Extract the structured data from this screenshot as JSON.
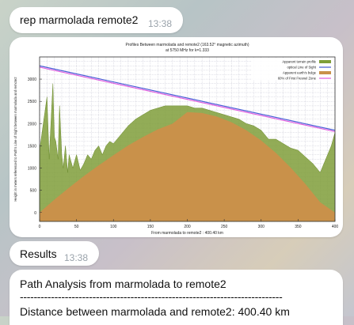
{
  "messages": [
    {
      "text": "rep marmolada remote2",
      "time": "13:38"
    },
    {
      "time": "13:38"
    },
    {
      "text": "Results",
      "time": "13:38"
    },
    {
      "lines": [
        "Path Analysis from marmolada to remote2",
        "----------------------------------------------------------------------------",
        "Distance between marmolada and remote2: 400.40 km"
      ]
    }
  ],
  "chart_data": {
    "type": "area",
    "title": "Profiles Between marmolada and remote2 (163.52° magnetic azimuth)",
    "subtitle": "at 5750 MHz for k=1.333",
    "xlabel": "From marmolada to remote2 : 400.40 km",
    "ylabel": "Height in meters referenced to Path's Line of Sight between marmolada and remote2",
    "xlim": [
      0,
      400
    ],
    "ylim": [
      -200,
      3500
    ],
    "xticks": [
      "0",
      "50",
      "100",
      "150",
      "200",
      "250",
      "300",
      "350",
      "400"
    ],
    "yticks": [
      "0",
      "500",
      "1000",
      "1500",
      "2000",
      "2500",
      "3000"
    ],
    "grid": true,
    "legend_position": "top-right",
    "series": [
      {
        "name": "Apparent terrain profile",
        "color": "#7f9e3a",
        "x": [
          0,
          5,
          10,
          13,
          15,
          18,
          20,
          22,
          25,
          27,
          30,
          32,
          35,
          38,
          40,
          45,
          50,
          55,
          60,
          65,
          70,
          75,
          80,
          85,
          90,
          95,
          100,
          110,
          120,
          130,
          140,
          150,
          160,
          170,
          180,
          190,
          200,
          210,
          220,
          230,
          240,
          250,
          260,
          270,
          280,
          290,
          300,
          310,
          320,
          330,
          340,
          350,
          360,
          370,
          380,
          385,
          390,
          395,
          400
        ],
        "values": [
          1400,
          2000,
          2600,
          1200,
          1900,
          2900,
          1700,
          1600,
          1200,
          2400,
          1300,
          1000,
          1500,
          900,
          1300,
          1000,
          1300,
          950,
          1100,
          1300,
          1200,
          1400,
          1500,
          1300,
          1500,
          1600,
          1550,
          1750,
          1950,
          2100,
          2200,
          2300,
          2350,
          2400,
          2400,
          2400,
          2400,
          2350,
          2350,
          2300,
          2250,
          2200,
          2150,
          2100,
          2000,
          1950,
          1850,
          1650,
          1650,
          1550,
          1450,
          1400,
          1250,
          1100,
          900,
          1100,
          1300,
          1500,
          1800
        ]
      },
      {
        "name": "optical Line of Sight",
        "color": "#4b5fd6",
        "x": [
          0,
          400
        ],
        "values": [
          3300,
          1850
        ]
      },
      {
        "name": "Apparent earth's bulge",
        "color": "#c9914a",
        "x": [
          0,
          20,
          40,
          60,
          80,
          100,
          120,
          140,
          160,
          180,
          200,
          220,
          240,
          260,
          280,
          300,
          320,
          340,
          360,
          380,
          400
        ],
        "values": [
          0,
          290,
          560,
          820,
          1060,
          1290,
          1510,
          1700,
          1870,
          2000,
          2260,
          2240,
          2160,
          2030,
          1850,
          1620,
          1340,
          1010,
          640,
          230,
          0
        ]
      },
      {
        "name": "60% of First Fresnel Zone",
        "color": "#e060e0",
        "x": [
          0,
          400
        ],
        "values": [
          3270,
          1820
        ]
      }
    ]
  }
}
